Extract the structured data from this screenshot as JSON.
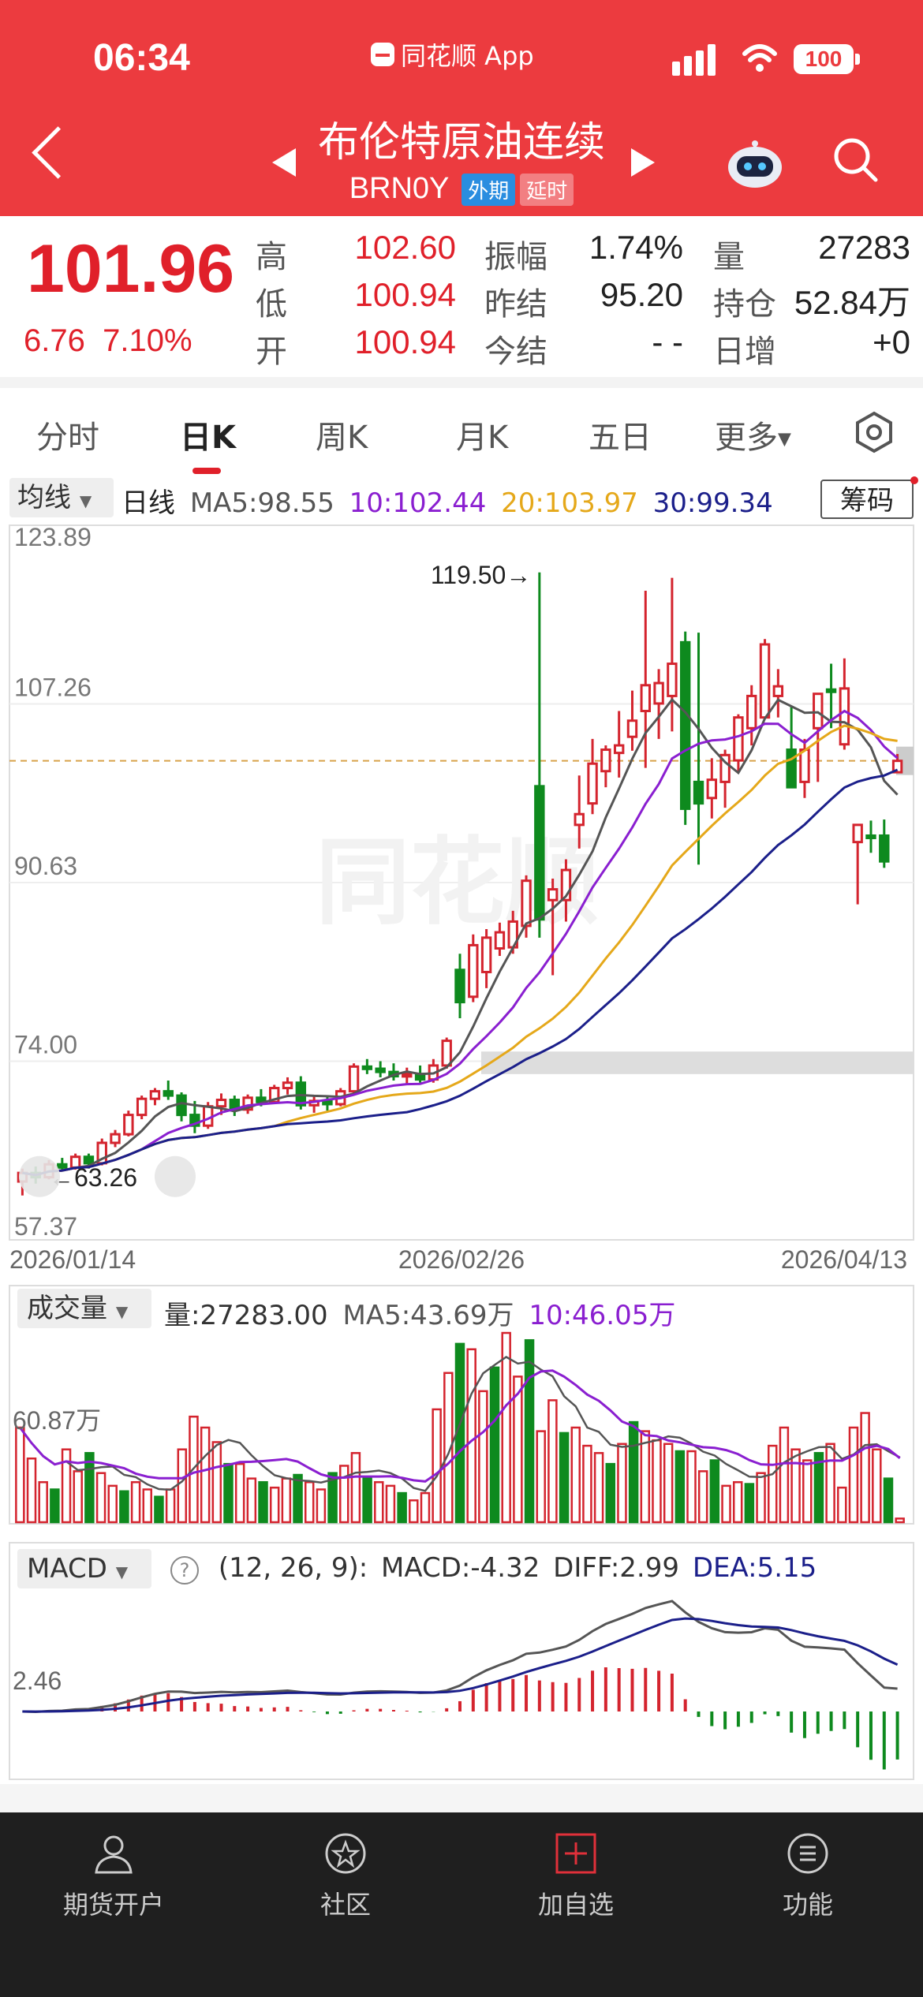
{
  "status": {
    "time": "06:34",
    "app_name": "同花顺 App",
    "battery": "100"
  },
  "header": {
    "title": "布伦特原油连续",
    "code": "BRN0Y",
    "tag_foreign": "外期",
    "tag_delay": "延时"
  },
  "quote": {
    "price": "101.96",
    "change": "6.76",
    "change_pct": "7.10%",
    "high_label": "高",
    "high": "102.60",
    "low_label": "低",
    "low": "100.94",
    "open_label": "开",
    "open": "100.94",
    "amp_label": "振幅",
    "amp": "1.74%",
    "prev_settle_label": "昨结",
    "prev_settle": "95.20",
    "today_settle_label": "今结",
    "today_settle": "- -",
    "volume_label": "量",
    "volume": "27283",
    "oi_label": "持仓",
    "oi": "52.84万",
    "daily_inc_label": "日增",
    "daily_inc": "+0"
  },
  "tabs": [
    "分时",
    "日K",
    "周K",
    "月K",
    "五日",
    "更多"
  ],
  "active_tab": "日K",
  "ma_bar": {
    "selector": "均线",
    "period": "日线",
    "ma5": "MA5:98.55",
    "ma10": "10:102.44",
    "ma20": "20:103.97",
    "ma30": "30:99.34",
    "chip_button": "筹码"
  },
  "colors": {
    "up": "#d4242e",
    "down": "#0e8a1e",
    "ma5": "#555555",
    "ma10": "#8a1fd0",
    "ma20": "#e5a81a",
    "ma30": "#1b1f8a",
    "header": "#ec3b3f"
  },
  "chart_data": [
    {
      "type": "candlestick",
      "title": "",
      "y_ticks": [
        "123.89",
        "107.26",
        "90.63",
        "74.00",
        "57.37"
      ],
      "ylim": [
        57.37,
        123.89
      ],
      "x_labels": [
        "2026/01/14",
        "2026/02/26",
        "2026/04/13"
      ],
      "max_marker": "119.50→",
      "min_marker": "←63.26",
      "last_price": 101.96,
      "candles": [
        [
          62.8,
          64.0,
          61.5,
          63.6
        ],
        [
          63.6,
          64.2,
          62.6,
          63.2
        ],
        [
          63.2,
          64.8,
          63.0,
          64.4
        ],
        [
          64.4,
          65.0,
          63.8,
          64.1
        ],
        [
          64.1,
          65.4,
          63.9,
          65.1
        ],
        [
          65.1,
          65.4,
          64.0,
          64.5
        ],
        [
          64.5,
          66.8,
          64.3,
          66.4
        ],
        [
          66.4,
          67.6,
          66.0,
          67.2
        ],
        [
          67.2,
          69.4,
          67.0,
          69.0
        ],
        [
          69.0,
          70.8,
          68.6,
          70.5
        ],
        [
          70.5,
          71.5,
          69.9,
          71.2
        ],
        [
          71.2,
          72.2,
          70.4,
          70.8
        ],
        [
          70.8,
          71.1,
          68.4,
          69.0
        ],
        [
          69.0,
          70.3,
          67.3,
          68.0
        ],
        [
          68.0,
          70.2,
          67.7,
          69.8
        ],
        [
          69.8,
          71.0,
          69.0,
          70.4
        ],
        [
          70.4,
          70.8,
          68.9,
          69.5
        ],
        [
          69.5,
          70.9,
          69.1,
          70.6
        ],
        [
          70.6,
          71.4,
          69.8,
          70.2
        ],
        [
          70.2,
          71.8,
          70.0,
          71.5
        ],
        [
          71.5,
          72.5,
          70.9,
          72.0
        ],
        [
          72.0,
          72.6,
          69.5,
          69.9
        ],
        [
          69.9,
          70.8,
          69.2,
          70.3
        ],
        [
          70.3,
          70.8,
          69.4,
          70.0
        ],
        [
          70.0,
          71.5,
          69.8,
          71.2
        ],
        [
          71.2,
          73.8,
          71.0,
          73.5
        ],
        [
          73.5,
          74.2,
          72.8,
          73.3
        ],
        [
          73.3,
          74.0,
          72.5,
          73.0
        ],
        [
          73.0,
          73.8,
          72.2,
          72.6
        ],
        [
          72.6,
          73.4,
          71.8,
          72.8
        ],
        [
          72.8,
          73.6,
          72.0,
          72.3
        ],
        [
          72.3,
          74.2,
          72.0,
          73.6
        ],
        [
          73.6,
          76.2,
          73.3,
          75.9
        ],
        [
          82.5,
          84.0,
          78.0,
          79.5
        ],
        [
          80.0,
          85.8,
          79.5,
          84.8
        ],
        [
          82.3,
          86.3,
          80.8,
          85.5
        ],
        [
          84.5,
          86.9,
          83.8,
          86.0
        ],
        [
          84.6,
          88.0,
          84.0,
          87.0
        ],
        [
          86.6,
          91.3,
          85.5,
          90.8
        ],
        [
          99.6,
          119.5,
          85.5,
          87.2
        ],
        [
          89.0,
          91.0,
          82.0,
          90.0
        ],
        [
          89.0,
          92.8,
          87.0,
          91.8
        ],
        [
          96.0,
          100.6,
          93.8,
          97.0
        ],
        [
          98.0,
          104.0,
          97.0,
          101.7
        ],
        [
          101.0,
          103.4,
          99.5,
          103.0
        ],
        [
          102.7,
          106.6,
          100.4,
          103.4
        ],
        [
          104.2,
          108.5,
          102.9,
          105.7
        ],
        [
          106.6,
          117.8,
          101.3,
          109.0
        ],
        [
          107.3,
          110.5,
          104.0,
          109.2
        ],
        [
          108.0,
          119.0,
          104.7,
          111.0
        ],
        [
          113.0,
          114.0,
          96.0,
          97.5
        ],
        [
          100.0,
          113.9,
          92.3,
          98.0
        ],
        [
          98.5,
          102.2,
          96.6,
          100.2
        ],
        [
          100.0,
          103.0,
          97.6,
          102.5
        ],
        [
          102.0,
          106.3,
          101.0,
          106.0
        ],
        [
          105.0,
          109.0,
          103.4,
          108.0
        ],
        [
          106.0,
          113.3,
          106.0,
          112.8
        ],
        [
          108.0,
          110.5,
          106.0,
          108.9
        ],
        [
          103.0,
          107.0,
          100.0,
          99.5
        ],
        [
          100.0,
          104.0,
          98.5,
          103.0
        ],
        [
          105.0,
          108.0,
          100.0,
          108.2
        ],
        [
          108.6,
          111.0,
          105.0,
          108.4
        ],
        [
          103.5,
          111.5,
          103.0,
          108.7
        ],
        [
          94.4,
          95.5,
          88.6,
          96.0
        ],
        [
          95.0,
          96.4,
          93.4,
          94.8
        ],
        [
          95.0,
          96.5,
          92.0,
          92.6
        ],
        [
          100.9,
          102.6,
          100.9,
          101.96
        ]
      ]
    },
    {
      "type": "bar",
      "title": "成交量",
      "summary": "量:27283.00",
      "ma5_label": "MA5:43.69万",
      "ma10_label": "10:46.05万",
      "y_tick": "60.87万",
      "values": [
        52,
        35,
        22,
        18,
        40,
        28,
        38,
        27,
        20,
        17,
        22,
        18,
        14,
        18,
        40,
        58,
        52,
        44,
        32,
        32,
        24,
        22,
        19,
        24,
        26,
        22,
        18,
        27,
        31,
        38,
        24,
        22,
        20,
        16,
        12,
        16,
        62,
        82,
        98,
        95,
        72,
        85,
        104,
        80,
        100,
        50,
        67,
        49,
        52,
        42,
        38,
        32,
        43,
        55,
        50,
        45,
        43,
        39,
        39,
        28,
        34,
        20,
        22,
        21,
        27,
        42,
        52,
        40,
        34,
        38,
        43,
        19,
        52,
        60,
        40,
        24,
        2
      ]
    },
    {
      "type": "bar",
      "title": "MACD",
      "params": "(12, 26, 9):",
      "macd_label": "MACD:-4.32",
      "diff_label": "DIFF:2.99",
      "dea_label": "DEA:5.15",
      "y_tick": "2.46"
    }
  ],
  "bottom_nav": [
    {
      "label": "期货开户",
      "icon": "user-icon"
    },
    {
      "label": "社区",
      "icon": "community-icon"
    },
    {
      "label": "加自选",
      "icon": "add-watchlist-icon"
    },
    {
      "label": "功能",
      "icon": "menu-icon"
    }
  ]
}
